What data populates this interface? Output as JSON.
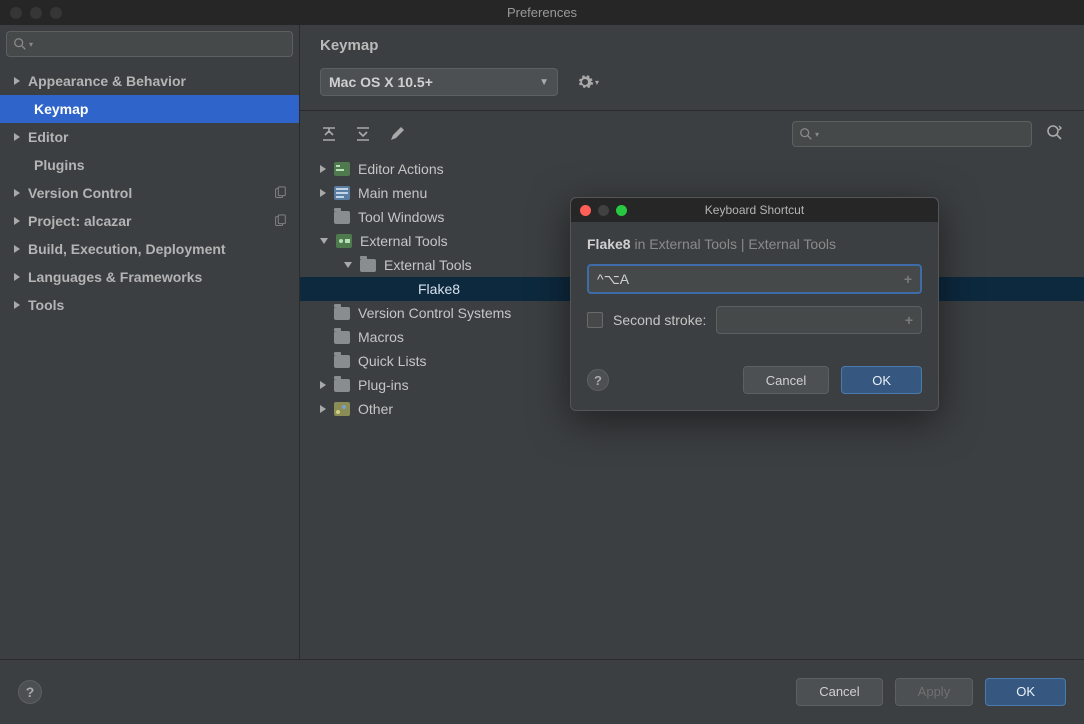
{
  "window": {
    "title": "Preferences"
  },
  "sidebar": {
    "items": [
      {
        "label": "Appearance & Behavior",
        "expandable": true
      },
      {
        "label": "Keymap",
        "selected": true
      },
      {
        "label": "Editor",
        "expandable": true
      },
      {
        "label": "Plugins"
      },
      {
        "label": "Version Control",
        "expandable": true,
        "badge": true
      },
      {
        "label": "Project: alcazar",
        "expandable": true,
        "badge": true
      },
      {
        "label": "Build, Execution, Deployment",
        "expandable": true
      },
      {
        "label": "Languages & Frameworks",
        "expandable": true
      },
      {
        "label": "Tools",
        "expandable": true
      }
    ]
  },
  "content": {
    "title": "Keymap",
    "scheme": "Mac OS X 10.5+",
    "tree": [
      {
        "label": "Editor Actions",
        "depth": 0,
        "arrow": "r",
        "icon": "special"
      },
      {
        "label": "Main menu",
        "depth": 0,
        "arrow": "r",
        "icon": "special"
      },
      {
        "label": "Tool Windows",
        "depth": 0,
        "arrow": "none",
        "icon": "folder"
      },
      {
        "label": "External Tools",
        "depth": 0,
        "arrow": "d",
        "icon": "special"
      },
      {
        "label": "External Tools",
        "depth": 1,
        "arrow": "d",
        "icon": "folder"
      },
      {
        "label": "Flake8",
        "depth": 2,
        "arrow": "none",
        "icon": "none",
        "selected": true
      },
      {
        "label": "Version Control Systems",
        "depth": 0,
        "arrow": "none",
        "icon": "folder"
      },
      {
        "label": "Macros",
        "depth": 0,
        "arrow": "none",
        "icon": "folder"
      },
      {
        "label": "Quick Lists",
        "depth": 0,
        "arrow": "none",
        "icon": "folder"
      },
      {
        "label": "Plug-ins",
        "depth": 0,
        "arrow": "r",
        "icon": "folder"
      },
      {
        "label": "Other",
        "depth": 0,
        "arrow": "r",
        "icon": "special"
      }
    ]
  },
  "footer": {
    "cancel": "Cancel",
    "apply": "Apply",
    "ok": "OK"
  },
  "dialog": {
    "title": "Keyboard Shortcut",
    "action": "Flake8",
    "path": " in External Tools | External Tools",
    "shortcut": "^⌥A",
    "second_label": "Second stroke:",
    "cancel": "Cancel",
    "ok": "OK"
  }
}
